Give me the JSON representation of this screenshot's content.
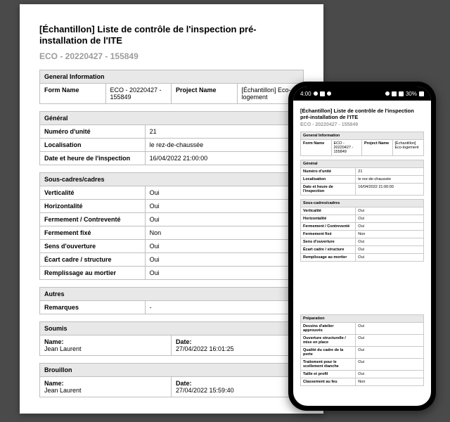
{
  "doc": {
    "title": "[Échantillon] Liste de contrôle de l'inspection pré-installation de l'ITE",
    "subtitle": "ECO - 20220427 - 155849",
    "general_info": {
      "header": "General Information",
      "form_name_label": "Form Name",
      "form_name_value": "ECO - 20220427 - 155849",
      "project_name_label": "Project Name",
      "project_name_value": "[Échantillon] Eco-logement"
    },
    "general": {
      "header": "Général",
      "rows": [
        {
          "label": "Numéro d'unité",
          "value": "21"
        },
        {
          "label": "Localisation",
          "value": "le rez-de-chaussée"
        },
        {
          "label": "Date et heure de l'inspection",
          "value": "16/04/2022 21:00:00"
        }
      ]
    },
    "sous_cadres": {
      "header": "Sous-cadres/cadres",
      "rows": [
        {
          "label": "Verticalité",
          "value": "Oui"
        },
        {
          "label": "Horizontalité",
          "value": "Oui"
        },
        {
          "label": "Fermement / Contreventé",
          "value": "Oui"
        },
        {
          "label": "Fermement fixé",
          "value": "Non"
        },
        {
          "label": "Sens d'ouverture",
          "value": "Oui"
        },
        {
          "label": "Écart cadre / structure",
          "value": "Oui"
        },
        {
          "label": "Remplissage au mortier",
          "value": "Oui"
        }
      ]
    },
    "autres": {
      "header": "Autres",
      "rows": [
        {
          "label": "Remarques",
          "value": "-"
        }
      ]
    },
    "soumis": {
      "header": "Soumis",
      "name_label": "Name:",
      "name_value": "Jean Laurent",
      "date_label": "Date:",
      "date_value": "27/04/2022 16:01:25"
    },
    "brouillon": {
      "header": "Brouillon",
      "name_label": "Name:",
      "name_value": "Jean Laurent",
      "date_label": "Date:",
      "date_value": "27/04/2022 15:59:40"
    }
  },
  "phone": {
    "status": {
      "time": "4:00",
      "battery": "30%"
    },
    "title": "[Échantillon] Liste de contrôle de l'inspection pré-installation de l'ITE",
    "subtitle": "ECO - 20220427 - 155849",
    "general_info": {
      "header": "General Information",
      "form_name_label": "Form Name",
      "form_name_value": "ECO - 20220427 - 155849",
      "project_name_label": "Project Name",
      "project_name_value": "[Échantillon] Eco-logement"
    },
    "general": {
      "header": "Général",
      "rows": [
        {
          "label": "Numéro d'unité",
          "value": "21"
        },
        {
          "label": "Localisation",
          "value": "le rez-de-chaussée"
        },
        {
          "label": "Date et heure de l'inspection",
          "value": "16/04/2022 21:00:00"
        }
      ]
    },
    "sous_cadres": {
      "header": "Sous-cadres/cadres",
      "rows": [
        {
          "label": "Verticalité",
          "value": "Oui"
        },
        {
          "label": "Horizontalité",
          "value": "Oui"
        },
        {
          "label": "Fermement / Contreventé",
          "value": "Oui"
        },
        {
          "label": "Fermement fixé",
          "value": "Non"
        },
        {
          "label": "Sens d'ouverture",
          "value": "Oui"
        },
        {
          "label": "Écart cadre / structure",
          "value": "Oui"
        },
        {
          "label": "Remplissage au mortier",
          "value": "Oui"
        }
      ]
    },
    "preparation": {
      "header": "Préparation",
      "rows": [
        {
          "label": "Dessins d'atelier approuvés",
          "value": "Oui"
        },
        {
          "label": "Ouverture structurelle / mise en place",
          "value": "Oui"
        },
        {
          "label": "Qualité du cadre de la porte",
          "value": "Oui"
        },
        {
          "label": "Traitement pour le scellement étanche",
          "value": "Oui"
        },
        {
          "label": "Taille et profil",
          "value": "Oui"
        },
        {
          "label": "Classement au feu",
          "value": "Non"
        }
      ]
    }
  }
}
